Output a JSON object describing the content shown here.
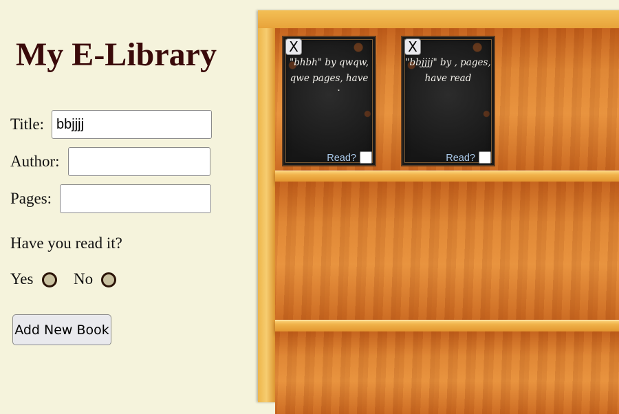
{
  "sidebar": {
    "title": "My E-Library",
    "title_label": "Title:",
    "title_value": "bbjjjj",
    "author_label": "Author:",
    "author_value": "",
    "pages_label": "Pages:",
    "pages_value": "",
    "read_question": "Have you read it?",
    "yes_label": "Yes",
    "no_label": "No",
    "add_button": "Add New Book"
  },
  "books": [
    {
      "delete_label": "X",
      "description": "\"bhbh\" by qwqw, qwe pages, have read",
      "read_label": "Read?",
      "read_checked": false
    },
    {
      "delete_label": "X",
      "description": "\"bbjjjj\" by , pages, have read",
      "read_label": "Read?",
      "read_checked": false
    }
  ],
  "colors": {
    "page_bg": "#f5f3dc",
    "title": "#3a0a0a",
    "book_cover": "#1e1e1e",
    "read_label": "#a9c8e8"
  }
}
